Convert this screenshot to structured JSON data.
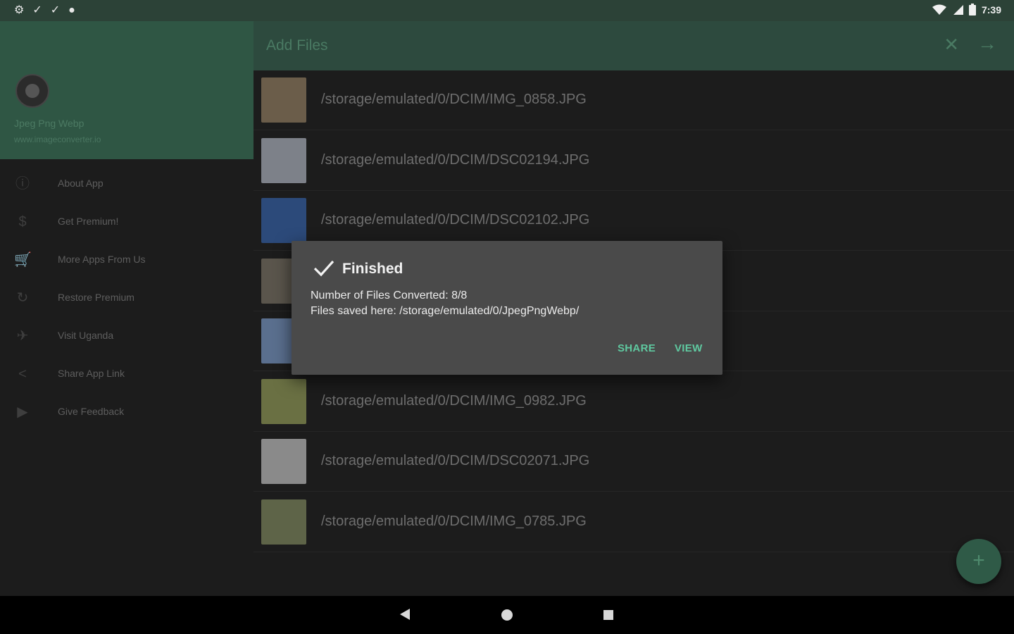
{
  "status_bar": {
    "time": "7:39",
    "left_icons": [
      "gear-icon",
      "check-icon",
      "check-icon",
      "circle-icon"
    ],
    "right_icons": [
      "wifi-icon",
      "signal-icon",
      "battery-icon"
    ]
  },
  "app_bar": {
    "title": "Add Files",
    "close_icon": "close-icon",
    "next_icon": "arrow-right-icon"
  },
  "drawer": {
    "app_name": "Jpeg Png Webp",
    "website": "www.imageconverter.io",
    "items": [
      {
        "label": "About App",
        "icon": "info-icon"
      },
      {
        "label": "Get Premium!",
        "icon": "dollar-icon"
      },
      {
        "label": "More Apps From Us",
        "icon": "cart-icon"
      },
      {
        "label": "Restore Premium",
        "icon": "restore-icon"
      },
      {
        "label": "Visit Uganda",
        "icon": "plane-icon"
      },
      {
        "label": "Share App Link",
        "icon": "share-icon"
      },
      {
        "label": "Give Feedback",
        "icon": "send-icon"
      }
    ]
  },
  "files": [
    {
      "path": "/storage/emulated/0/DCIM/IMG_0858.JPG",
      "thumb_color": "#6b5d4a"
    },
    {
      "path": "/storage/emulated/0/DCIM/DSC02194.JPG",
      "thumb_color": "#7d8189"
    },
    {
      "path": "/storage/emulated/0/DCIM/DSC02102.JPG",
      "thumb_color": "#2c4a7a"
    },
    {
      "path": "",
      "thumb_color": "#5a554c"
    },
    {
      "path": "",
      "thumb_color": "#5a6f8e"
    },
    {
      "path": "/storage/emulated/0/DCIM/IMG_0982.JPG",
      "thumb_color": "#6a7043"
    },
    {
      "path": "/storage/emulated/0/DCIM/DSC02071.JPG",
      "thumb_color": "#8a8a8a"
    },
    {
      "path": "/storage/emulated/0/DCIM/IMG_0785.JPG",
      "thumb_color": "#5e6448"
    }
  ],
  "fab": {
    "label": "+"
  },
  "dialog": {
    "title": "Finished",
    "line1": "Number of Files Converted: 8/8",
    "line2": "Files saved here: /storage/emulated/0/JpegPngWebp/",
    "share_label": "SHARE",
    "view_label": "VIEW"
  },
  "nav_bar": {
    "icons": [
      "back-icon",
      "home-icon",
      "recents-icon"
    ]
  }
}
